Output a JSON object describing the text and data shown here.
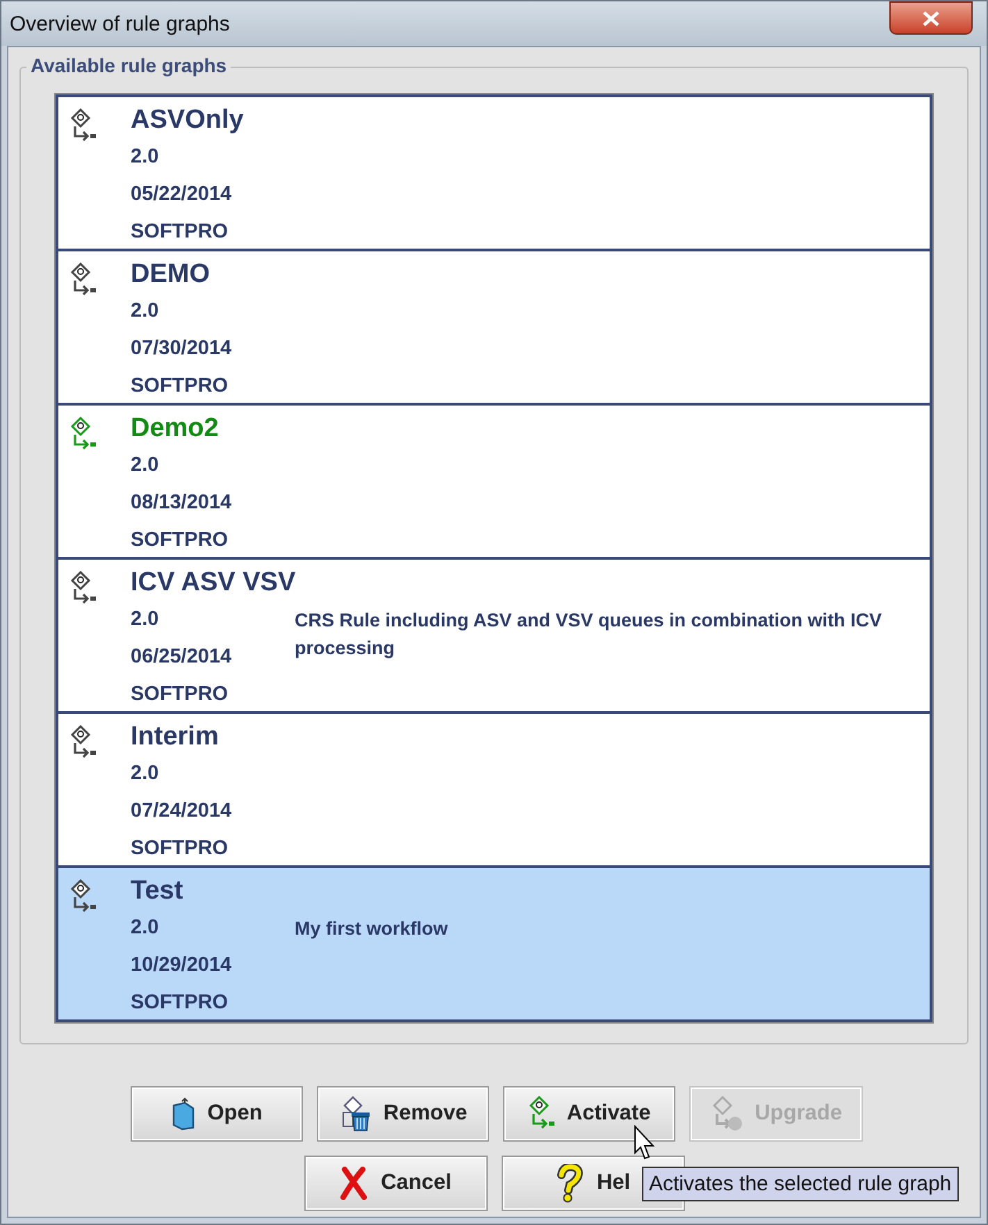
{
  "window": {
    "title": "Overview of rule graphs"
  },
  "group": {
    "title": "Available rule graphs"
  },
  "rule_graphs": [
    {
      "name": "ASVOnly",
      "version": "2.0",
      "date": "05/22/2014",
      "vendor": "SOFTPRO",
      "active": false,
      "selected": false
    },
    {
      "name": "DEMO",
      "version": "2.0",
      "date": "07/30/2014",
      "vendor": "SOFTPRO",
      "active": false,
      "selected": false
    },
    {
      "name": "Demo2",
      "version": "2.0",
      "date": "08/13/2014",
      "vendor": "SOFTPRO",
      "active": true,
      "selected": false
    },
    {
      "name": "ICV ASV VSV",
      "version": "2.0",
      "date": "06/25/2014",
      "vendor": "SOFTPRO",
      "description": "CRS Rule including ASV and VSV queues in combination with ICV processing",
      "active": false,
      "selected": false
    },
    {
      "name": "Interim",
      "version": "2.0",
      "date": "07/24/2014",
      "vendor": "SOFTPRO",
      "active": false,
      "selected": false
    },
    {
      "name": "Test",
      "version": "2.0",
      "date": "10/29/2014",
      "vendor": "SOFTPRO",
      "description": "My first workflow",
      "active": false,
      "selected": true
    }
  ],
  "button_rows": [
    [
      {
        "label": "Open",
        "kind": "open",
        "disabled": false
      },
      {
        "label": "Remove",
        "kind": "remove",
        "disabled": false
      },
      {
        "label": "Activate",
        "kind": "activate",
        "disabled": false
      },
      {
        "label": "Upgrade",
        "kind": "upgrade",
        "disabled": true
      }
    ],
    [
      {
        "label": "Cancel",
        "kind": "cancel",
        "disabled": false
      },
      {
        "label": "Hel",
        "kind": "help",
        "disabled": false
      }
    ]
  ],
  "tooltip": {
    "text": "Activates the selected rule graph"
  }
}
